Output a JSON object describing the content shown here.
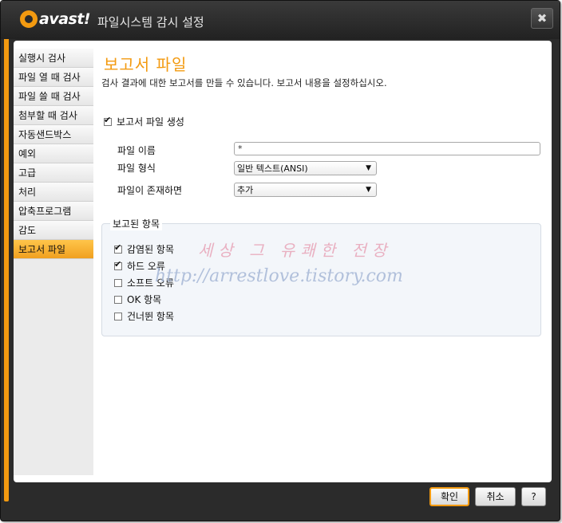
{
  "window": {
    "title": "파일시스템 감시 설정",
    "logo_text": "avast!",
    "close_label": "✖"
  },
  "sidebar": {
    "items": [
      {
        "label": "실행시 검사"
      },
      {
        "label": "파일 열 때 검사"
      },
      {
        "label": "파일 쓸 때 검사"
      },
      {
        "label": "첨부할 때 검사"
      },
      {
        "label": "자동샌드박스"
      },
      {
        "label": "예외"
      },
      {
        "label": "고급"
      },
      {
        "label": "처리"
      },
      {
        "label": "압축프로그램"
      },
      {
        "label": "감도"
      },
      {
        "label": "보고서 파일"
      }
    ],
    "active_index": 10
  },
  "main": {
    "title": "보고서 파일",
    "description": "검사 결과에 대한 보고서를 만들 수 있습니다. 보고서 내용을 설정하십시오.",
    "create_report": {
      "label": "보고서 파일 생성",
      "checked": true
    },
    "file_name": {
      "label": "파일 이름",
      "value": "*"
    },
    "file_type": {
      "label": "파일 형식",
      "selected": "일반 텍스트(ANSI)"
    },
    "file_exists": {
      "label": "파일이 존재하면",
      "selected": "추가"
    },
    "reported_items": {
      "title": "보고된 항목",
      "items": [
        {
          "label": "감염된 항목",
          "checked": true
        },
        {
          "label": "하드 오류",
          "checked": true
        },
        {
          "label": "소프트 오류",
          "checked": false
        },
        {
          "label": "OK 항목",
          "checked": false
        },
        {
          "label": "건너뛴 항목",
          "checked": false
        }
      ]
    }
  },
  "watermark": {
    "line1": "세상 그 유쾌한 전장",
    "line2": "http://arrestlove.tistory.com"
  },
  "buttons": {
    "ok": "확인",
    "cancel": "취소",
    "help": "?"
  },
  "colors": {
    "accent": "#f39a10",
    "titlebar": "#2b2b2b"
  }
}
